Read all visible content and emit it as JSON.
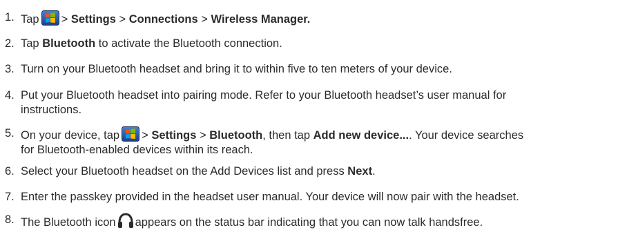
{
  "steps": [
    {
      "number": "1.",
      "prefix": "Tap",
      "icon": "windows-start-icon",
      "sep1": ">",
      "bold1": "Settings",
      "sep2": ">",
      "bold2": "Connections",
      "sep3": ">",
      "bold3": "Wireless Manager."
    },
    {
      "number": "2.",
      "prefix": "Tap",
      "bold1": "Bluetooth",
      "suffix": "to activate the Bluetooth connection."
    },
    {
      "number": "3.",
      "text": "Turn on your Bluetooth headset and bring it to within five to ten meters of your device."
    },
    {
      "number": "4.",
      "line1": "Put your Bluetooth headset into pairing mode. Refer to your Bluetooth headset’s user manual for",
      "line2": "instructions."
    },
    {
      "number": "5.",
      "prefix": "On your device, tap",
      "icon": "windows-start-icon",
      "sep1": ">",
      "bold1": "Settings",
      "sep2": ">",
      "bold2": "Bluetooth",
      "mid": ", then tap",
      "bold3": "Add new device...",
      "suffix": ". Your device searches",
      "line2": "for Bluetooth-enabled devices within its reach."
    },
    {
      "number": "6.",
      "prefix": "Select your Bluetooth headset on the Add Devices list and press",
      "bold1": "Next",
      "suffix": "."
    },
    {
      "number": "7.",
      "text": "Enter the passkey provided in the headset user manual. Your device will now pair with the headset."
    },
    {
      "number": "8.",
      "prefix": "The Bluetooth icon",
      "icon": "bluetooth-headset-icon",
      "suffix": "appears on the status bar indicating that you can now talk handsfree."
    }
  ]
}
